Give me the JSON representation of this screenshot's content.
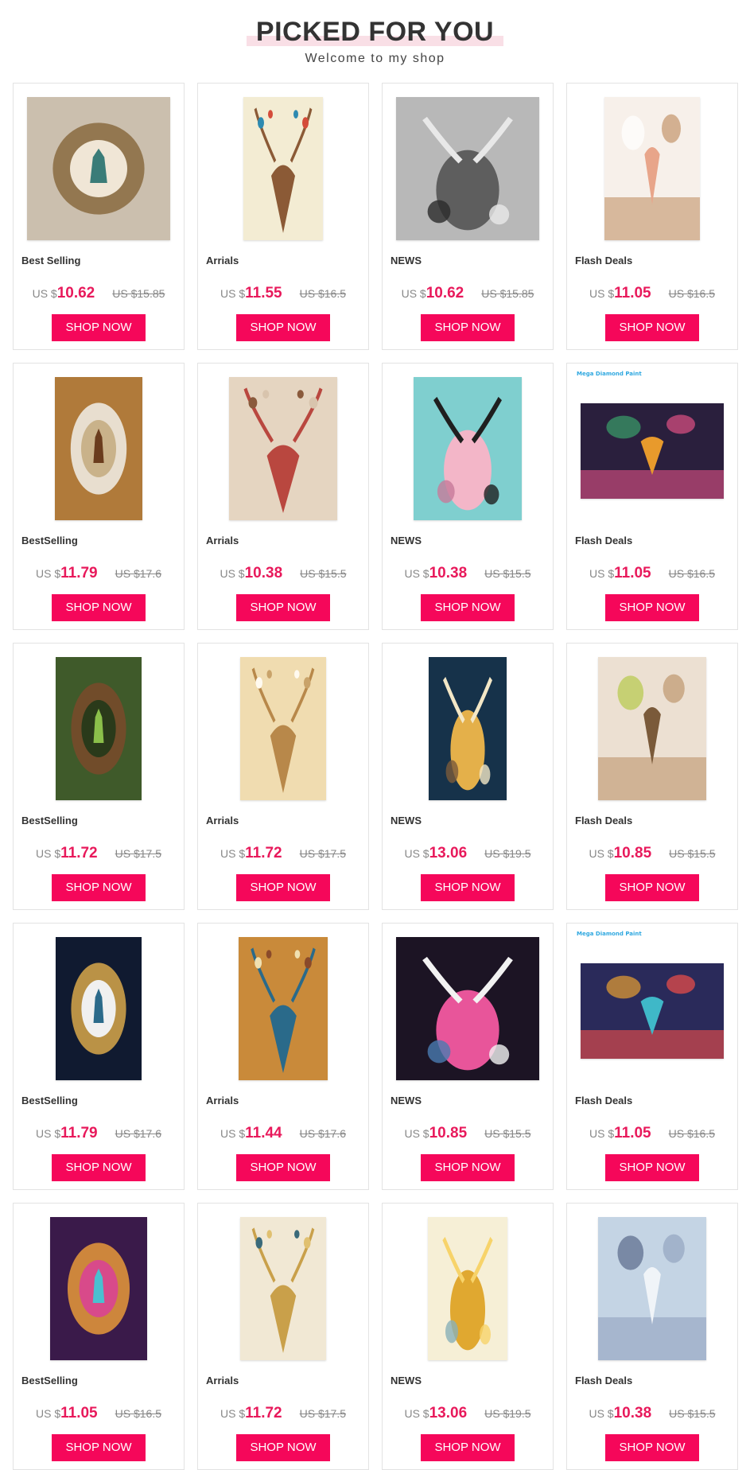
{
  "header": {
    "title": "PICKED FOR YOU",
    "subtitle": "Welcome to my shop"
  },
  "button_label": "SHOP NOW",
  "colors": {
    "accent": "#f5075a",
    "price": "#e8195b",
    "title_highlight": "#f9dfe6"
  },
  "products": [
    {
      "category": "Best Selling",
      "currency": "US $",
      "price": "10.62",
      "old_price": "US $15.85",
      "image": "deer-mandala-painting"
    },
    {
      "category": "Arrials",
      "currency": "US $",
      "price": "11.55",
      "old_price": "US $16.5",
      "image": "deer-with-birds-painting"
    },
    {
      "category": "NEWS",
      "currency": "US $",
      "price": "10.62",
      "old_price": "US $15.85",
      "image": "silver-deer-painting"
    },
    {
      "category": "Flash Deals",
      "currency": "US $",
      "price": "11.05",
      "old_price": "US $16.5",
      "image": "white-deer-flowers-painting"
    },
    {
      "category": "BestSelling",
      "currency": "US $",
      "price": "11.79",
      "old_price": "US $17.6",
      "image": "white-horses-painting"
    },
    {
      "category": "Arrials",
      "currency": "US $",
      "price": "10.38",
      "old_price": "US $15.5",
      "image": "deer-red-roses-painting"
    },
    {
      "category": "NEWS",
      "currency": "US $",
      "price": "10.38",
      "old_price": "US $15.5",
      "image": "black-panther-blossoms-painting"
    },
    {
      "category": "Flash Deals",
      "currency": "US $",
      "price": "11.05",
      "old_price": "US $16.5",
      "image": "psychedelic-deer-painting",
      "brand": "Mega Diamond Paint"
    },
    {
      "category": "BestSelling",
      "currency": "US $",
      "price": "11.72",
      "old_price": "US $17.5",
      "image": "deer-in-forest-painting"
    },
    {
      "category": "Arrials",
      "currency": "US $",
      "price": "11.72",
      "old_price": "US $17.5",
      "image": "golden-deer-birds-painting"
    },
    {
      "category": "NEWS",
      "currency": "US $",
      "price": "13.06",
      "old_price": "US $19.5",
      "image": "golden-tree-deer-painting"
    },
    {
      "category": "Flash Deals",
      "currency": "US $",
      "price": "10.85",
      "old_price": "US $15.5",
      "image": "deer-tree-antlers-painting"
    },
    {
      "category": "BestSelling",
      "currency": "US $",
      "price": "11.79",
      "old_price": "US $17.6",
      "image": "leaping-golden-deer-painting"
    },
    {
      "category": "Arrials",
      "currency": "US $",
      "price": "11.44",
      "old_price": "US $17.6",
      "image": "ornate-elephant-painting"
    },
    {
      "category": "NEWS",
      "currency": "US $",
      "price": "10.85",
      "old_price": "US $15.5",
      "image": "white-deer-roses-painting"
    },
    {
      "category": "Flash Deals",
      "currency": "US $",
      "price": "11.05",
      "old_price": "US $16.5",
      "image": "colorful-deer-abstract-painting",
      "brand": "Mega Diamond Paint"
    },
    {
      "category": "BestSelling",
      "currency": "US $",
      "price": "11.05",
      "old_price": "US $16.5",
      "image": "fantasy-deer-painting"
    },
    {
      "category": "Arrials",
      "currency": "US $",
      "price": "11.72",
      "old_price": "US $17.5",
      "image": "golden-tree-painting"
    },
    {
      "category": "NEWS",
      "currency": "US $",
      "price": "13.06",
      "old_price": "US $19.5",
      "image": "golden-deer-heart-painting"
    },
    {
      "category": "Flash Deals",
      "currency": "US $",
      "price": "10.38",
      "old_price": "US $15.5",
      "image": "white-horse-butterflies-painting"
    }
  ]
}
